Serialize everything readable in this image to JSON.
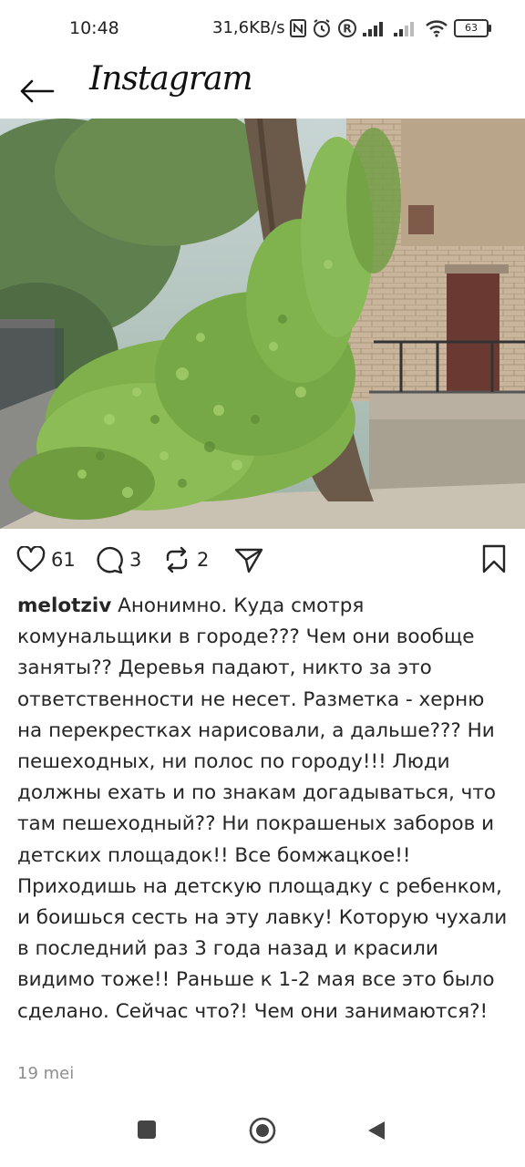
{
  "status_bar": {
    "time": "10:48",
    "network_speed": "31,6KB/s",
    "battery": "63",
    "icons": [
      "nfc-icon",
      "alarm-icon",
      "registered-icon",
      "signal-icon",
      "signal-icon",
      "wifi-icon",
      "battery-icon"
    ]
  },
  "header": {
    "back_icon": "arrow-left-icon",
    "app_name": "Instagram"
  },
  "post": {
    "image_alt": "",
    "actions": {
      "likes": "61",
      "comments": "3",
      "reposts": "2"
    },
    "username": "melotziv",
    "caption": "Анонимно. Куда смотря комунальщики в городе??? Чем они вообще заняты?? Деревья падают, никто за это ответственности не несет. Разметка - херню на перекрестках нарисовали, а дальше??? Ни пешеходных, ни полос по городу!!! Люди должны ехать и по знакам догадываться, что там пешеходный?? Ни покрашеных заборов и детских площадок!! Все бомжацкое!! Приходишь на детскую площадку с ребенком, и боишься сесть на эту лавку! Которую чухали в последний раз 3 года назад и красили видимо тоже!! Раньше к 1-2 мая все это было сделано. Сейчас что?! Чем они занимаются?!",
    "date": "19 mei"
  },
  "navbar": {
    "icons": [
      "square-icon",
      "circle-home-icon",
      "triangle-back-icon"
    ]
  },
  "colors": {
    "text": "#262626",
    "muted": "#8e8e8e",
    "background": "#ffffff"
  }
}
